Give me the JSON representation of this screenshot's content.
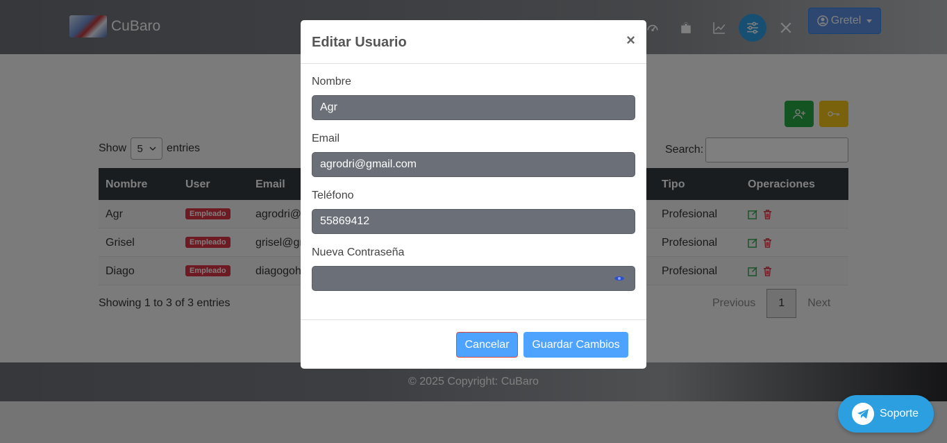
{
  "navbar": {
    "brand": "CuBaro",
    "icons": [
      "speedometer-icon",
      "bag-icon",
      "chart-line-icon",
      "sliders-icon",
      "tools-icon"
    ],
    "user": "Gretel"
  },
  "table": {
    "show_label": "Show",
    "entries_value": "5",
    "entries_label": "entries",
    "search_label": "Search:",
    "headers": [
      "Nombre",
      "User",
      "Email",
      "Tipo",
      "Operaciones"
    ],
    "rows": [
      {
        "nombre": "Agr",
        "user": "Empleado",
        "email": "agrodri@",
        "tipo": "Profesional"
      },
      {
        "nombre": "Grisel",
        "user": "Empleado",
        "email": "grisel@gr",
        "tipo": "Profesional"
      },
      {
        "nombre": "Diago",
        "user": "Empleado",
        "email": "diagogoh",
        "tipo": "Profesional"
      }
    ],
    "info": "Showing 1 to 3 of 3 entries",
    "pagination": {
      "previous": "Previous",
      "current": "1",
      "next": "Next"
    }
  },
  "footer": {
    "text": "© 2025 Copyright: CuBaro"
  },
  "support": {
    "label": "Soporte"
  },
  "modal": {
    "title": "Editar Usuario",
    "close": "×",
    "fields": {
      "nombre_label": "Nombre",
      "nombre_value": "Agr",
      "email_label": "Email",
      "email_value": "agrodri@gmail.com",
      "telefono_label": "Teléfono",
      "telefono_value": "55869412",
      "password_label": "Nueva Contraseña",
      "password_value": ""
    },
    "cancel": "Cancelar",
    "save": "Guardar Cambios"
  }
}
